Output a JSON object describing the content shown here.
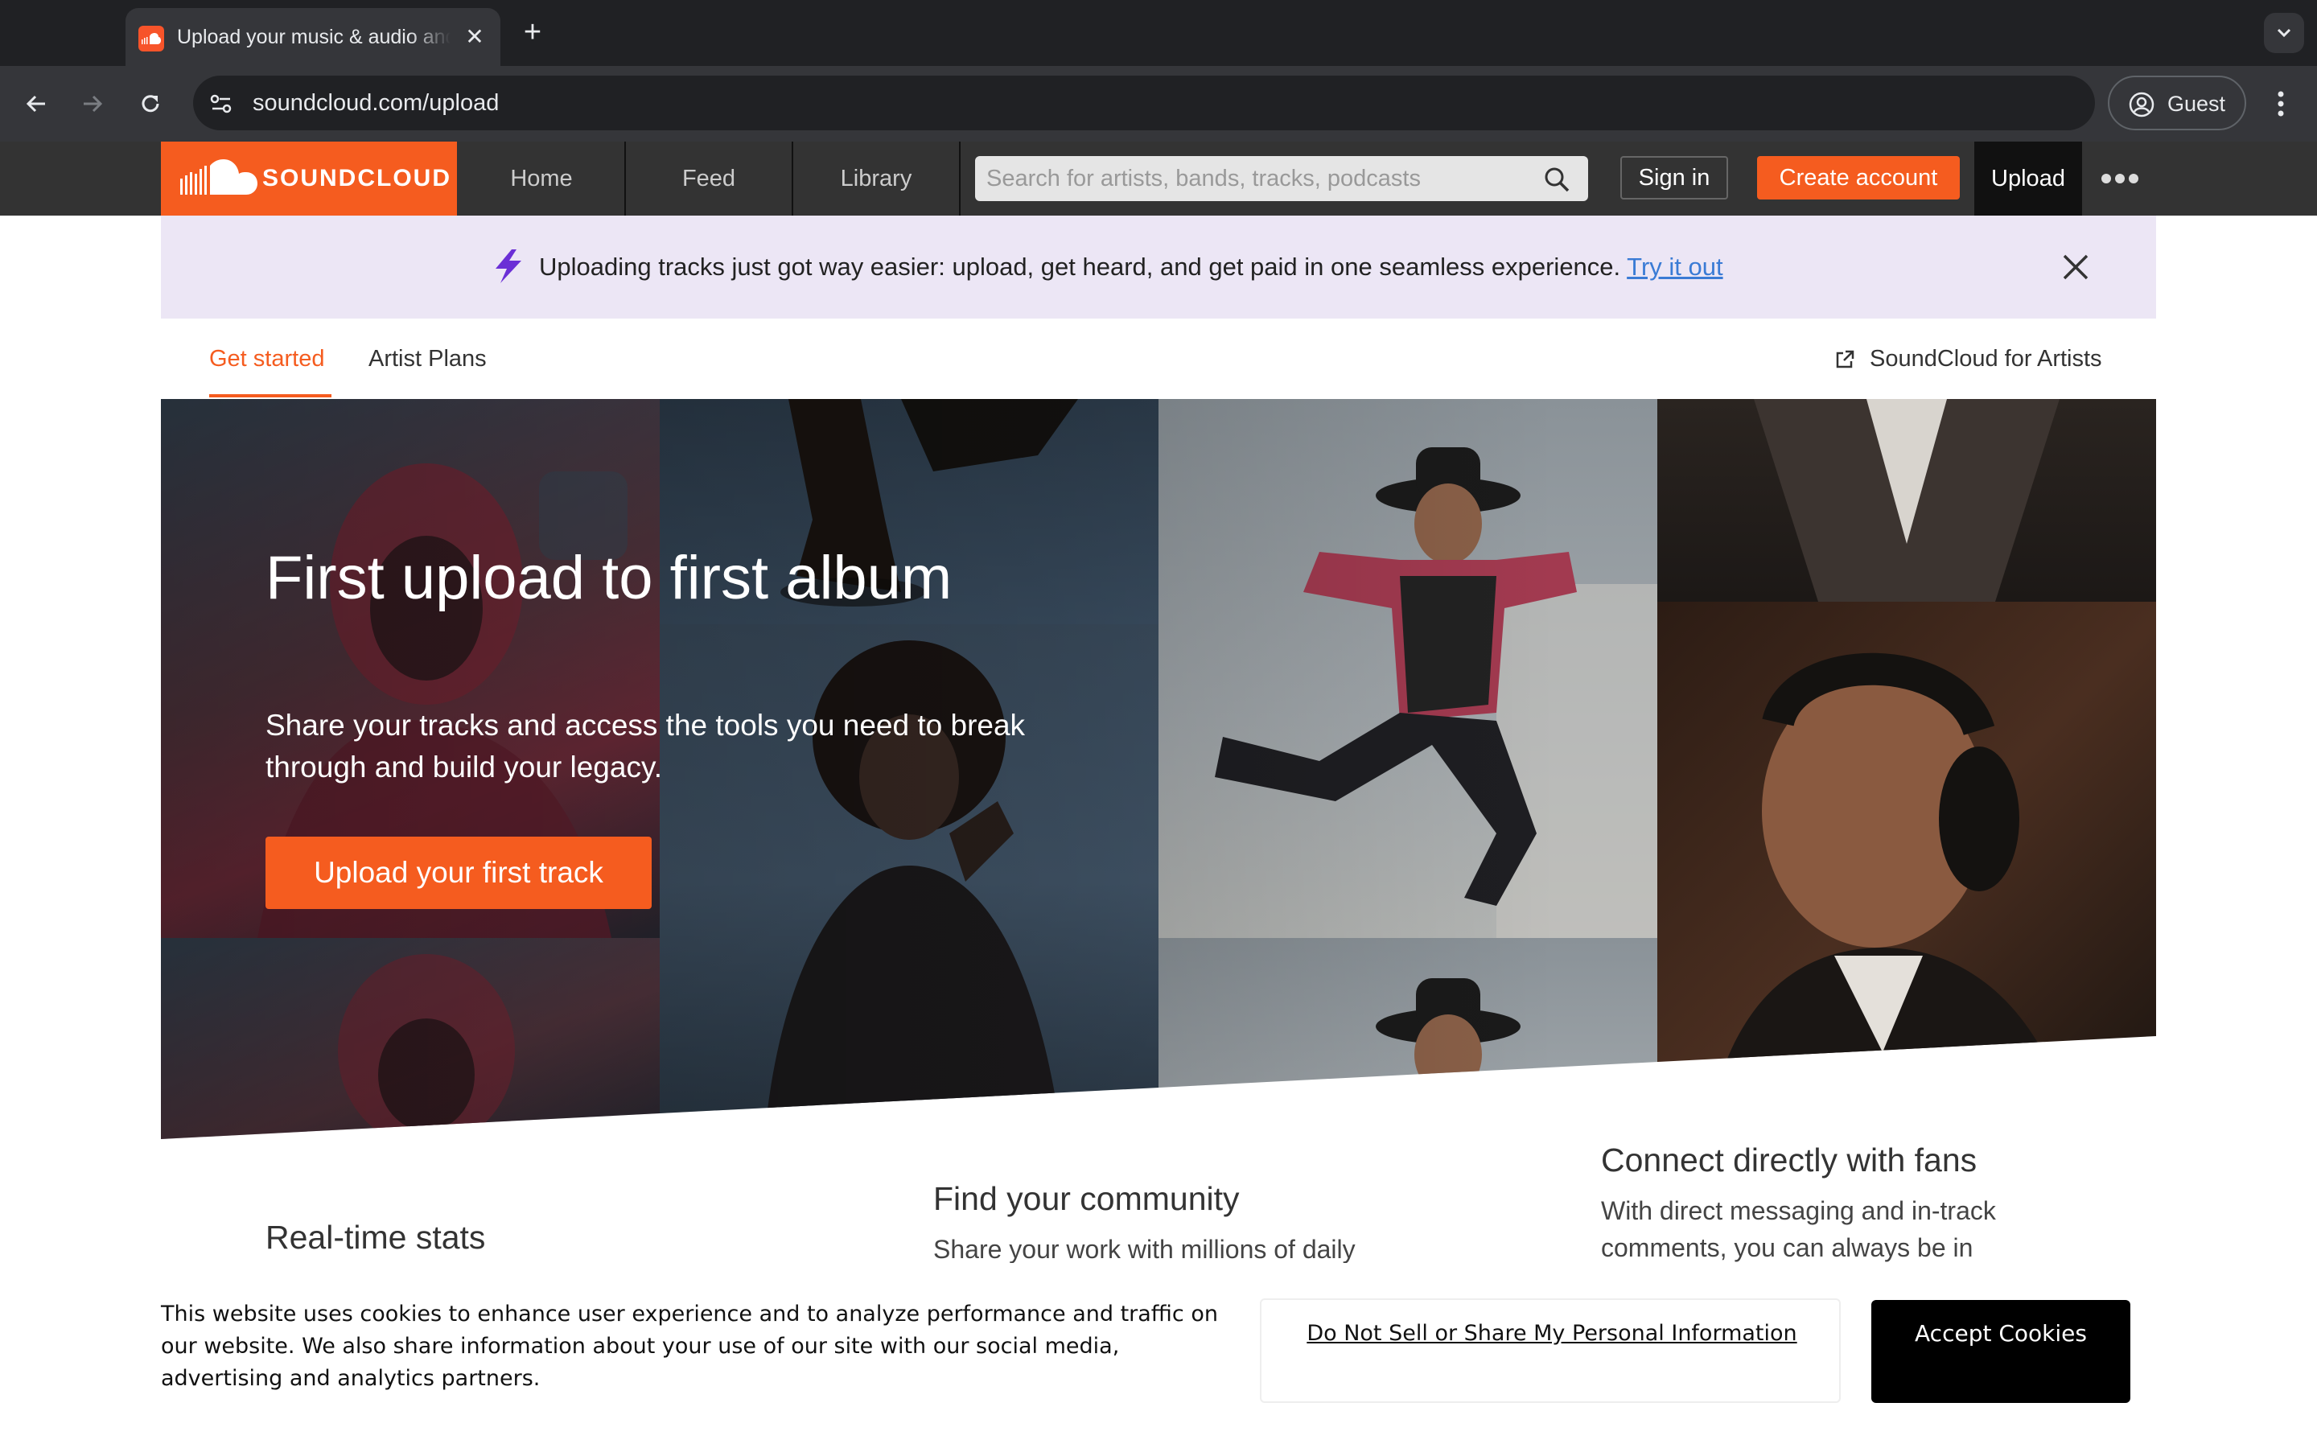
{
  "browser": {
    "tab_title": "Upload your music & audio and share it with the world",
    "tab_close": "✕",
    "new_tab": "+",
    "url": "soundcloud.com/upload",
    "guest_label": "Guest"
  },
  "header": {
    "logo_text": "SOUNDCLOUD",
    "nav": [
      {
        "label": "Home"
      },
      {
        "label": "Feed"
      },
      {
        "label": "Library"
      }
    ],
    "search_placeholder": "Search for artists, bands, tracks, podcasts",
    "signin_label": "Sign in",
    "create_account_label": "Create account",
    "upload_label": "Upload"
  },
  "banner": {
    "text": "Uploading tracks just got way easier: upload, get heard, and get paid in one seamless experience.",
    "link_text": "Try it out"
  },
  "subnav": {
    "tabs": [
      {
        "label": "Get started",
        "active": true
      },
      {
        "label": "Artist Plans",
        "active": false
      }
    ],
    "artists_link": "SoundCloud for Artists"
  },
  "hero": {
    "title": "First upload to first album",
    "subtitle": "Share your tracks and access the tools you need to break through and build your legacy.",
    "cta": "Upload your first track"
  },
  "features": [
    {
      "title": "Real-time stats",
      "body": ""
    },
    {
      "title": "Find your community",
      "body": "Share your work with millions of daily"
    },
    {
      "title": "Connect directly with fans",
      "body": "With direct messaging and in-track comments, you can always be in"
    }
  ],
  "cookie": {
    "text": "This website uses cookies to enhance user experience and to analyze performance and traffic on our website. We also share information about your use of our site with our social media, advertising and analytics partners.",
    "do_not_sell": "Do Not Sell or Share My Personal Information",
    "accept": "Accept Cookies"
  },
  "colors": {
    "brand": "#f55c1f",
    "header_bg": "#333333",
    "banner_bg": "#ece6f5",
    "link": "#3a7bd5"
  }
}
